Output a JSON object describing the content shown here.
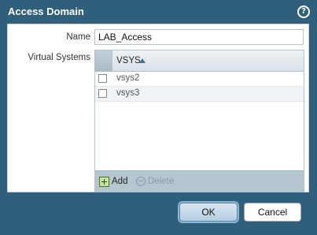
{
  "dialog": {
    "title": "Access Domain",
    "help_icon": "question-circle-icon",
    "help_glyph": "?"
  },
  "form": {
    "name_label": "Name",
    "name_value": "LAB_Access",
    "vsys_label": "Virtual Systems"
  },
  "grid": {
    "column_header": "VSYS",
    "sort_direction": "ascending",
    "rows": [
      {
        "label": "vsys2",
        "checked": false
      },
      {
        "label": "vsys3",
        "checked": false
      }
    ],
    "add_label": "Add",
    "delete_label": "Delete"
  },
  "buttons": {
    "ok_label": "OK",
    "cancel_label": "Cancel"
  },
  "colors": {
    "frame": "#2f5f7a",
    "accent": "#3a6f93"
  }
}
